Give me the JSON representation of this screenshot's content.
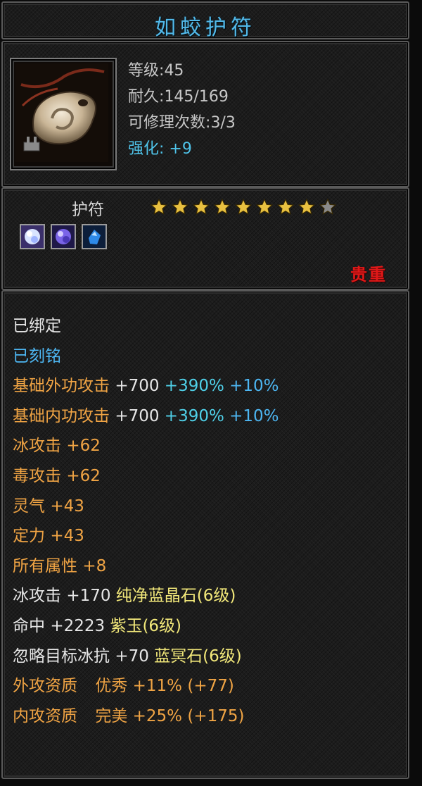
{
  "title": "如蛟护符",
  "info": {
    "level_label": "等级",
    "level_value": "45",
    "durability_label": "耐久",
    "durability_value": "145/169",
    "repairs_label": "可修理次数",
    "repairs_value": "3/3",
    "enhance_label": "强化",
    "enhance_value": "+9",
    "icon": "jade-pendant-icon"
  },
  "item_type": "护符",
  "stars": {
    "filled": 8,
    "total": 9,
    "filled_color": "#e8c040",
    "empty_color": "#8a8a8a"
  },
  "gems": [
    {
      "name": "white-gem-icon",
      "color": "#d8e4ff"
    },
    {
      "name": "purple-gem-icon",
      "color": "#7a64e8"
    },
    {
      "name": "blue-gem-icon",
      "color": "#2e8ae8"
    }
  ],
  "rarity": "贵重",
  "status": {
    "bound": "已绑定",
    "engraved": "已刻铭"
  },
  "attributes": {
    "base_outer": {
      "label": "基础外功攻击",
      "value": "+700",
      "pct1": "+390%",
      "pct2": "+10%"
    },
    "base_inner": {
      "label": "基础内功攻击",
      "value": "+700",
      "pct1": "+390%",
      "pct2": "+10%"
    },
    "ice_attack": {
      "label": "冰攻击",
      "value": "+62"
    },
    "poison_attack": {
      "label": "毒攻击",
      "value": "+62"
    },
    "spirit": {
      "label": "灵气",
      "value": "+43"
    },
    "focus": {
      "label": "定力",
      "value": "+43"
    },
    "all_attrs": {
      "label": "所有属性",
      "value": "+8"
    }
  },
  "socketed": [
    {
      "label": "冰攻击",
      "value": "+170",
      "gem": "纯净蓝晶石(6级)"
    },
    {
      "label": "命中",
      "value": "+2223",
      "gem": "紫玉(6级)"
    },
    {
      "label": "忽略目标冰抗",
      "value": "+70",
      "gem": "蓝冥石(6级)"
    }
  ],
  "aptitudes": [
    {
      "label": "外攻资质",
      "grade": "优秀",
      "value": "+11%",
      "bonus": "(+77)"
    },
    {
      "label": "内攻资质",
      "grade": "完美",
      "value": "+25%",
      "bonus": "(+175)"
    }
  ],
  "colors": {
    "enhance": "#4fc4ea",
    "rarity": "#e01818",
    "attr": "#f0a444",
    "gem_name": "#f2e87a"
  }
}
